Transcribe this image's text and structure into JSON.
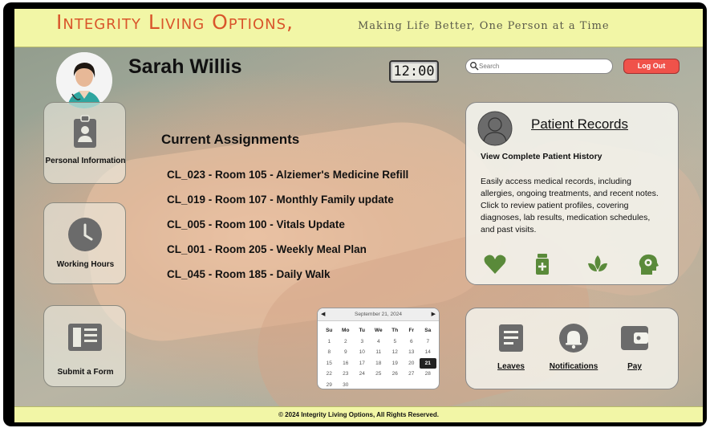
{
  "header": {
    "brand": "Integrity Living Options,",
    "tagline": "Making Life Better, One Person at a Time"
  },
  "user": {
    "name": "Sarah Willis"
  },
  "clock": {
    "time": "12:00"
  },
  "search": {
    "placeholder": "Search"
  },
  "logout": {
    "label": "Log Out"
  },
  "sidebar": {
    "items": [
      {
        "label": "Personal Information",
        "icon": "id-badge-icon"
      },
      {
        "label": "Working Hours",
        "icon": "clock-icon"
      },
      {
        "label": "Submit a Form",
        "icon": "form-icon"
      }
    ]
  },
  "assignments": {
    "title": "Current Assignments",
    "items": [
      "CL_023 - Room 105 - Alziemer's Medicine Refill",
      "CL_019 - Room 107 - Monthly Family update",
      "CL_005 - Room 100 - Vitals Update",
      "CL_001 - Room 205 - Weekly Meal Plan",
      "CL_045 - Room 185 - Daily Walk"
    ]
  },
  "records": {
    "title": "Patient Records",
    "subtitle": "View Complete Patient History",
    "description1": "Easily access medical records, including allergies, ongoing treatments, and recent notes.",
    "description2": "Click to review patient profiles, covering diagnoses, lab results, medication schedules, and past visits.",
    "icons": [
      "heart-icon",
      "medicine-bottle-icon",
      "leaf-icon",
      "head-gear-icon"
    ],
    "icon_color": "#5a8a3a"
  },
  "calendar": {
    "month_label": "September 21, 2024",
    "prev": "◀",
    "next": "▶",
    "days_of_week": [
      "Su",
      "Mo",
      "Tu",
      "We",
      "Th",
      "Fr",
      "Sa"
    ],
    "weeks": [
      [
        "1",
        "2",
        "3",
        "4",
        "5",
        "6",
        "7"
      ],
      [
        "8",
        "9",
        "10",
        "11",
        "12",
        "13",
        "14"
      ],
      [
        "15",
        "16",
        "17",
        "18",
        "19",
        "20",
        "21"
      ],
      [
        "22",
        "23",
        "24",
        "25",
        "26",
        "27",
        "28"
      ],
      [
        "29",
        "30",
        "",
        "",
        "",
        "",
        ""
      ]
    ],
    "selected": "21"
  },
  "quick_links": [
    {
      "label": "Leaves",
      "icon": "document-icon"
    },
    {
      "label": "Notifications",
      "icon": "bell-icon"
    },
    {
      "label": "Pay",
      "icon": "wallet-icon"
    }
  ],
  "footer": {
    "text": "© 2024 Integrity Living Options, All Rights Reserved."
  },
  "colors": {
    "header_bg": "#f2f6a6",
    "brand": "#d9552b",
    "logout": "#f0524a",
    "icon_gray": "#6b6b6b"
  }
}
